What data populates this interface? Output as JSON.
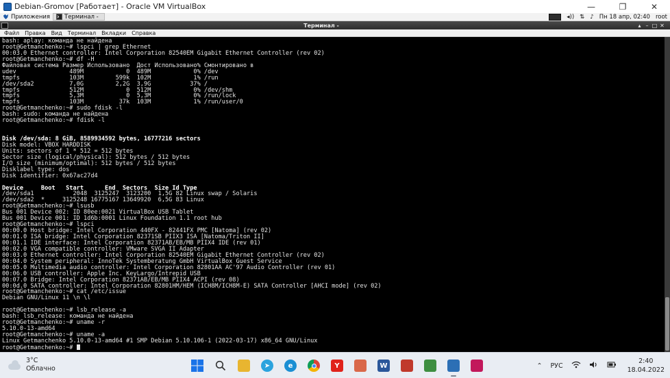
{
  "vbox_window": {
    "title": "Debian-Gromov [Работает] - Oracle VM VirtualBox",
    "minimize": "—",
    "restore": "❐",
    "close": "✕"
  },
  "guest_panel": {
    "apps_label": "Приложения",
    "task_label": "Терминал -",
    "datetime": "Пн 18 апр, 02:40",
    "user": "root"
  },
  "terminal": {
    "title": "Терминал -",
    "controls": [
      "▴",
      "–",
      "□",
      "✕"
    ],
    "menu": [
      "Файл",
      "Правка",
      "Вид",
      "Терминал",
      "Вкладки",
      "Справка"
    ],
    "lines": [
      {
        "t": "bash: aplay: команда не найдена"
      },
      {
        "t": "root@Getmanchenko:~# lspci | grep Ethernet"
      },
      {
        "t": "00:03.0 Ethernet controller: Intel Corporation 82540EM Gigabit Ethernet Controller (rev 02)"
      },
      {
        "t": "root@Getmanchenko:~# df -H"
      },
      {
        "t": "Файловая система Размер Использовано  Дост Использовано% Смонтировано в"
      },
      {
        "t": "udev               489M            0  489M            0% /dev"
      },
      {
        "t": "tmpfs              103M         599k  102M            1% /run"
      },
      {
        "t": "/dev/sda2          7,0G         2,2G  3,9G           37% /"
      },
      {
        "t": "tmpfs              512M            0  512M            0% /dev/shm"
      },
      {
        "t": "tmpfs              5,3M            0  5,3M            0% /run/lock"
      },
      {
        "t": "tmpfs              103M          37k  103M            1% /run/user/0"
      },
      {
        "t": "root@Getmanchenko:~# sudo fdisk -l"
      },
      {
        "t": "bash: sudo: команда не найдена"
      },
      {
        "t": "root@Getmanchenko:~# fdisk -l"
      },
      {
        "t": ""
      },
      {
        "t": ""
      },
      {
        "t": "Disk /dev/sda: 8 GiB, 8589934592 bytes, 16777216 sectors",
        "b": true
      },
      {
        "t": "Disk model: VBOX HARDDISK"
      },
      {
        "t": "Units: sectors of 1 * 512 = 512 bytes"
      },
      {
        "t": "Sector size (logical/physical): 512 bytes / 512 bytes"
      },
      {
        "t": "I/O size (minimum/optimal): 512 bytes / 512 bytes"
      },
      {
        "t": "Disklabel type: dos"
      },
      {
        "t": "Disk identifier: 0x67ac27d4"
      },
      {
        "t": ""
      },
      {
        "t": "Device     Boot   Start      End  Sectors  Size Id Type",
        "b": true
      },
      {
        "t": "/dev/sda1           2048  3125247  3123200  1,5G 82 Linux swap / Solaris"
      },
      {
        "t": "/dev/sda2  *     3125248 16775167 13649920  6,5G 83 Linux"
      },
      {
        "t": "root@Getmanchenko:~# lsusb"
      },
      {
        "t": "Bus 001 Device 002: ID 80ee:0021 VirtualBox USB Tablet"
      },
      {
        "t": "Bus 001 Device 001: ID 1d6b:0001 Linux Foundation 1.1 root hub"
      },
      {
        "t": "root@Getmanchenko:~# lspci"
      },
      {
        "t": "00:00.0 Host bridge: Intel Corporation 440FX - 82441FX PMC [Natoma] (rev 02)"
      },
      {
        "t": "00:01.0 ISA bridge: Intel Corporation 82371SB PIIX3 ISA [Natoma/Triton II]"
      },
      {
        "t": "00:01.1 IDE interface: Intel Corporation 82371AB/EB/MB PIIX4 IDE (rev 01)"
      },
      {
        "t": "00:02.0 VGA compatible controller: VMware SVGA II Adapter"
      },
      {
        "t": "00:03.0 Ethernet controller: Intel Corporation 82540EM Gigabit Ethernet Controller (rev 02)"
      },
      {
        "t": "00:04.0 System peripheral: InnoTek Systemberatung GmbH VirtualBox Guest Service"
      },
      {
        "t": "00:05.0 Multimedia audio controller: Intel Corporation 82801AA AC'97 Audio Controller (rev 01)"
      },
      {
        "t": "00:06.0 USB controller: Apple Inc. KeyLargo/Intrepid USB"
      },
      {
        "t": "00:07.0 Bridge: Intel Corporation 82371AB/EB/MB PIIX4 ACPI (rev 08)"
      },
      {
        "t": "00:0d.0 SATA controller: Intel Corporation 82801HM/HEM (ICH8M/ICH8M-E) SATA Controller [AHCI mode] (rev 02)"
      },
      {
        "t": "root@Getmanchenko:~# cat /etc/issue"
      },
      {
        "t": "Debian GNU/Linux 11 \\n \\l"
      },
      {
        "t": ""
      },
      {
        "t": "root@Getmanchenko:~# lsb_release -a"
      },
      {
        "t": "bash: lsb_release: команда не найдена"
      },
      {
        "t": "root@Getmanchenko:~# uname -r"
      },
      {
        "t": "5.10.0-13-amd64"
      },
      {
        "t": "root@Getmanchenko:~# uname -a"
      },
      {
        "t": "Linux Getmanchenko 5.10.0-13-amd64 #1 SMP Debian 5.10.106-1 (2022-03-17) x86_64 GNU/Linux"
      },
      {
        "t": "root@Getmanchenko:~# "
      }
    ]
  },
  "taskbar": {
    "weather_temp": "3°C",
    "weather_desc": "Облачно",
    "apps": [
      {
        "name": "start-button",
        "glyph": "",
        "color": "#1a73e8",
        "active": false
      },
      {
        "name": "search-app",
        "glyph": "",
        "color": "#4a4a4a",
        "active": false
      },
      {
        "name": "file-explorer-app",
        "glyph": "",
        "color": "#e8b530",
        "active": false
      },
      {
        "name": "telegram-app",
        "glyph": "➤",
        "color": "#2aa3de",
        "active": false
      },
      {
        "name": "edge-app",
        "glyph": "e",
        "color": "#1b8fd3",
        "active": false
      },
      {
        "name": "chrome-app",
        "glyph": "",
        "color": "#db4437",
        "active": false
      },
      {
        "name": "yandex-app",
        "glyph": "Y",
        "color": "#e0231b",
        "active": false
      },
      {
        "name": "photo-editor-app",
        "glyph": "",
        "color": "#d9684a",
        "active": false
      },
      {
        "name": "word-app",
        "glyph": "W",
        "color": "#2b579a",
        "active": false
      },
      {
        "name": "recorder-app",
        "glyph": "",
        "color": "#c0392b",
        "active": false
      },
      {
        "name": "sticky-notes-app",
        "glyph": "",
        "color": "#3e8e41",
        "active": false
      },
      {
        "name": "virtualbox-app",
        "glyph": "",
        "color": "#2c6fb5",
        "active": true
      },
      {
        "name": "media-app",
        "glyph": "",
        "color": "#c2185b",
        "active": false
      }
    ],
    "tray_chevron": "⌃",
    "language": "РУС",
    "time": "2:40",
    "date": "18.04.2022"
  }
}
